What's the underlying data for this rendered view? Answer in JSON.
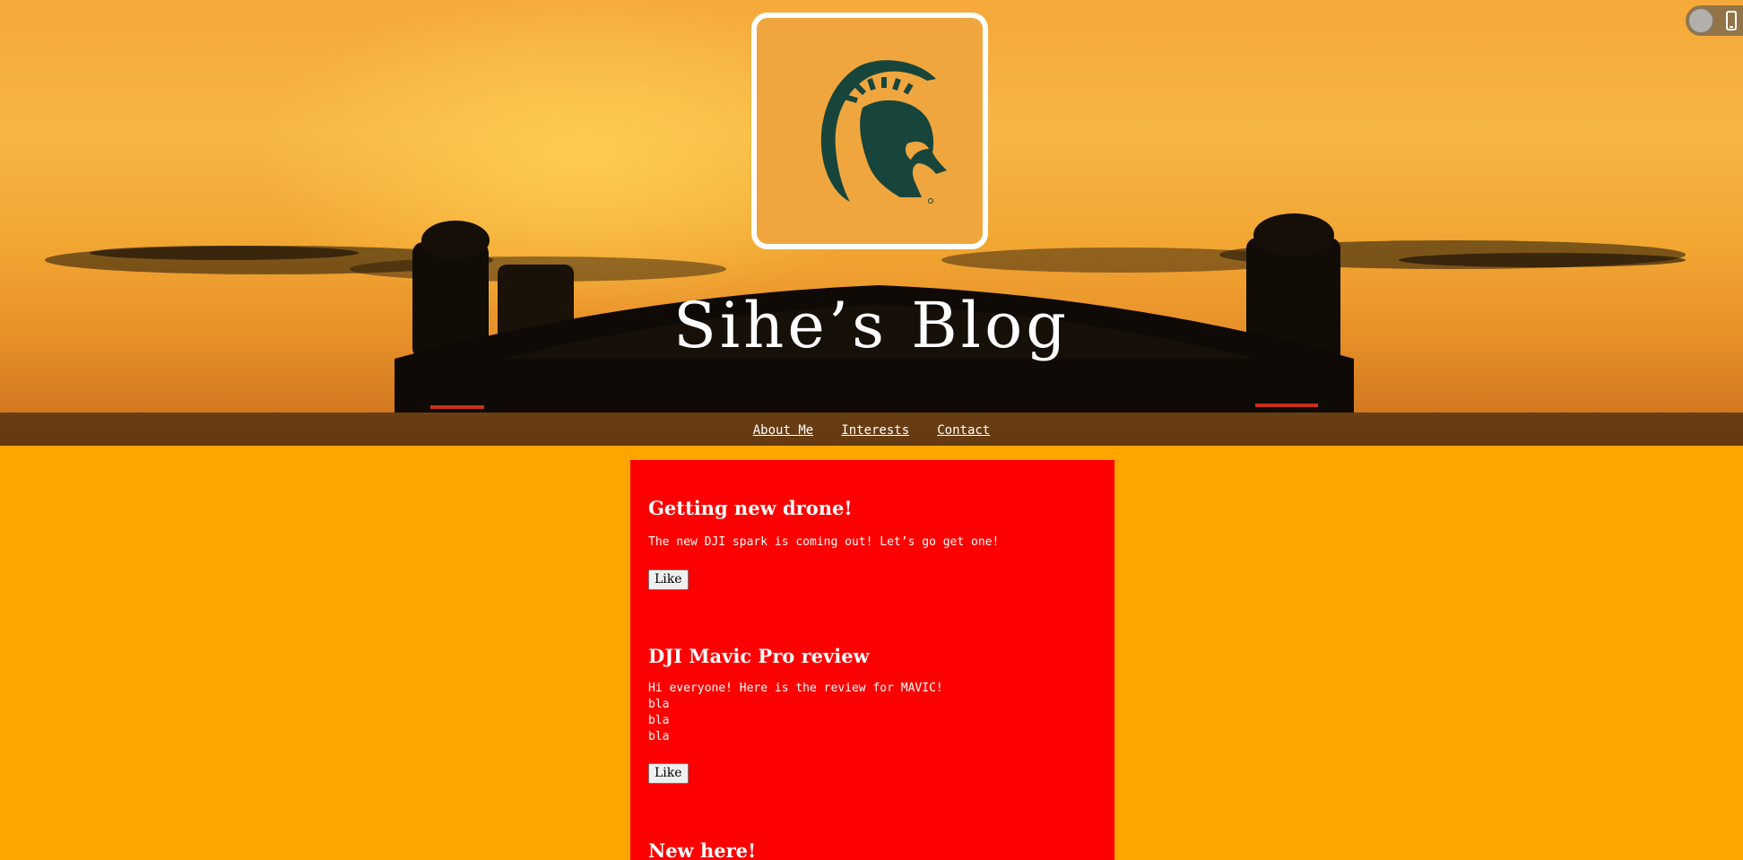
{
  "header": {
    "site_title": "Sihe’s Blog",
    "logo": "spartan-helmet-logo"
  },
  "nav": {
    "items": [
      {
        "label": "About Me"
      },
      {
        "label": "Interests"
      },
      {
        "label": "Contact"
      }
    ]
  },
  "top_widget": {
    "toggle": "toggle-knob",
    "icon": "mobile-phone-icon"
  },
  "posts": [
    {
      "title": "Getting new drone!",
      "body": "The new DJI spark is coming out! Let’s go get one!",
      "like_label": "Like"
    },
    {
      "title": "DJI Mavic Pro review",
      "body": "Hi everyone! Here is the review for MAVIC!\nbla\nbla\nbla",
      "like_label": "Like"
    },
    {
      "title": "New here!"
    }
  ],
  "colors": {
    "page_background": "#ffa500",
    "posts_background": "#ff0000",
    "logo_green": "#18453b",
    "text": "#ffffff"
  }
}
